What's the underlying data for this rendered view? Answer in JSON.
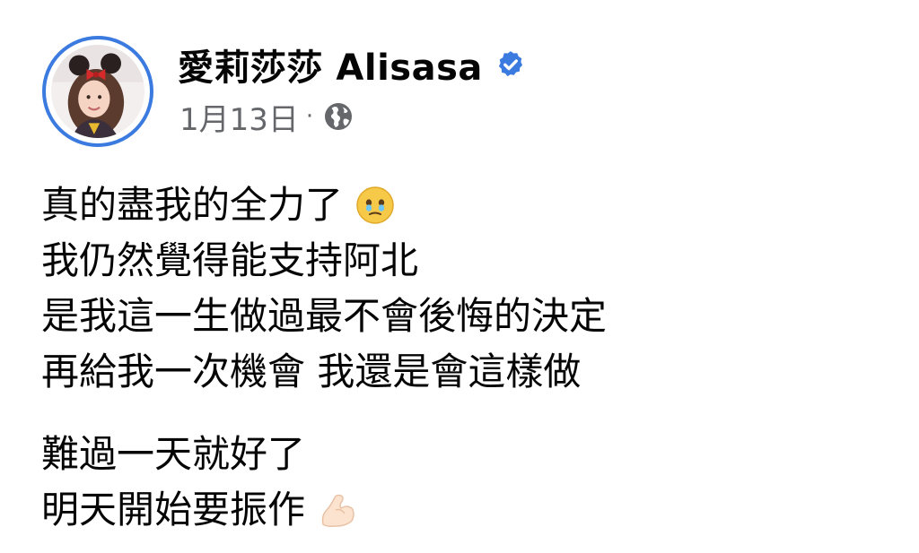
{
  "post": {
    "author": "愛莉莎莎 Alisasa",
    "date": "1月13日",
    "separator": "·",
    "icons": {
      "verified": "verified-badge-icon",
      "audience": "globe-icon",
      "emoji_1": "smiling-face-with-tear-emoji",
      "emoji_2": "flexed-biceps-emoji"
    },
    "lines": [
      "真的盡我的全力了",
      "我仍然覺得能支持阿北",
      "是我這一生做過最不會後悔的決定",
      "再給我一次機會 我還是會這樣做",
      "難過一天就好了",
      "明天開始要振作"
    ]
  },
  "colors": {
    "verified_blue": "#3b7be0",
    "meta_gray": "#65676b",
    "text": "#050505"
  }
}
